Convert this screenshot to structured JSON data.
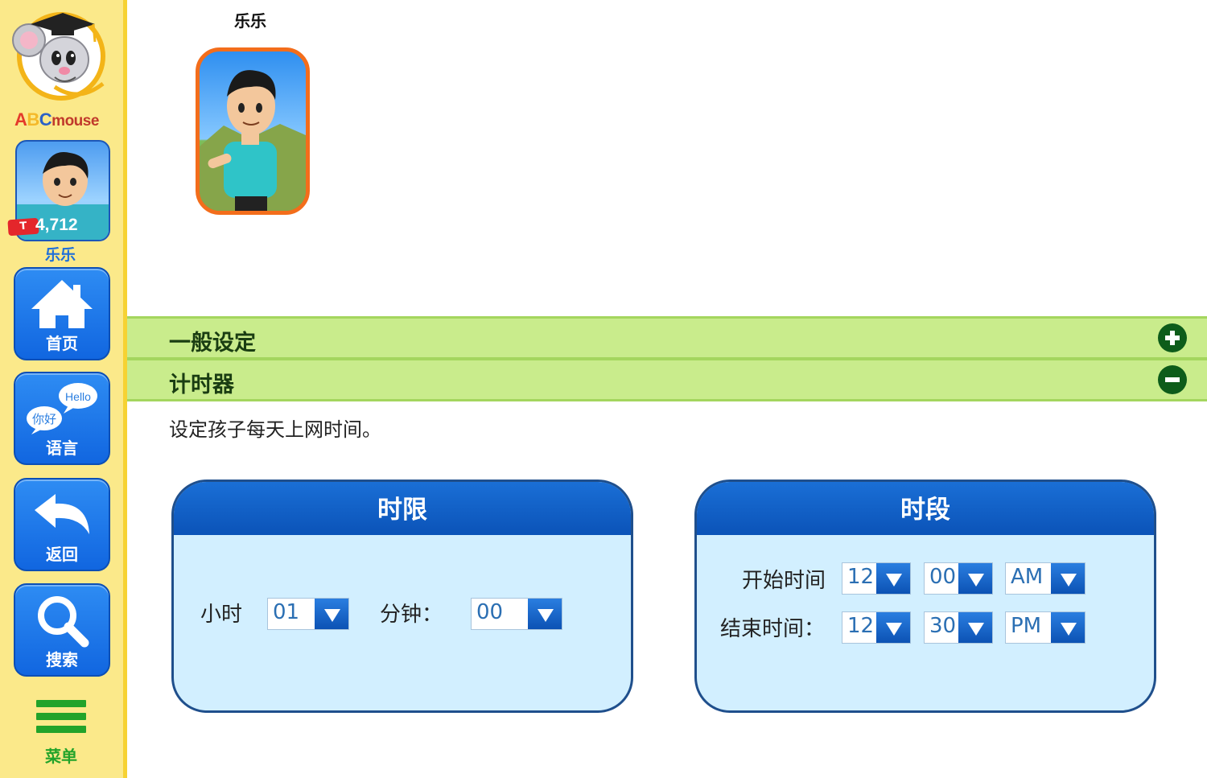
{
  "sidebar": {
    "logo": {
      "brand_a": "A",
      "brand_b": "B",
      "brand_c": "C",
      "brand_rest": "mouse"
    },
    "profile": {
      "ticket_badge": "T",
      "ticket_count": "4,712",
      "name": "乐乐"
    },
    "nav": [
      {
        "label": "首页",
        "icon": "home-icon"
      },
      {
        "label": "语言",
        "icon": "language-icon",
        "bubble_en": "Hello",
        "bubble_zh": "你好"
      },
      {
        "label": "返回",
        "icon": "back-arrow-icon"
      },
      {
        "label": "搜索",
        "icon": "search-icon"
      }
    ],
    "menu_label": "菜单"
  },
  "child": {
    "name": "乐乐"
  },
  "sections": {
    "general": {
      "title": "一般设定",
      "state": "collapsed"
    },
    "timer": {
      "title": "计时器",
      "state": "expanded"
    }
  },
  "timer": {
    "description": "设定孩子每天上网时间。",
    "limit": {
      "title": "时限",
      "hours_label": "小时",
      "hours_value": "01",
      "minutes_label": "分钟：",
      "minutes_value": "00"
    },
    "period": {
      "title": "时段",
      "start_label": "开始时间",
      "start_hour": "12",
      "start_minute": "00",
      "start_ampm": "AM",
      "end_label": "结束时间：",
      "end_hour": "12",
      "end_minute": "30",
      "end_ampm": "PM"
    }
  },
  "colors": {
    "sidebar_bg": "#fbe98a",
    "nav_blue": "#1a72e6",
    "section_green": "#c9ec8c",
    "panel_bg": "#d2efff",
    "panel_header": "#0b53b8",
    "avatar_border": "#f36d1b",
    "menu_green": "#22a32a"
  }
}
